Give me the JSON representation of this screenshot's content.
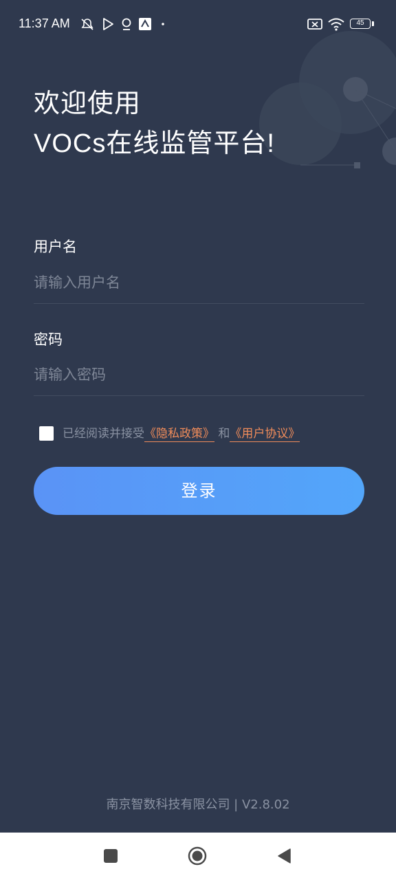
{
  "status_bar": {
    "time": "11:37 AM",
    "battery": "45"
  },
  "welcome": {
    "line1": "欢迎使用",
    "line2": "VOCs在线监管平台!"
  },
  "username": {
    "label": "用户名",
    "placeholder": "请输入用户名",
    "value": ""
  },
  "password": {
    "label": "密码",
    "placeholder": "请输入密码",
    "value": ""
  },
  "agreement": {
    "checked": false,
    "prefix": "已经阅读并接受",
    "privacy_link": "《隐私政策》",
    "and": "和",
    "user_agreement_link": "《用户协议》",
    "link_color": "#f08c5a"
  },
  "login_button": {
    "label": "登录"
  },
  "footer": {
    "text": "南京智数科技有限公司 | V2.8.02"
  },
  "colors": {
    "background": "#2f394e",
    "button_start": "#5a93f6",
    "button_end": "#53a6fa"
  }
}
